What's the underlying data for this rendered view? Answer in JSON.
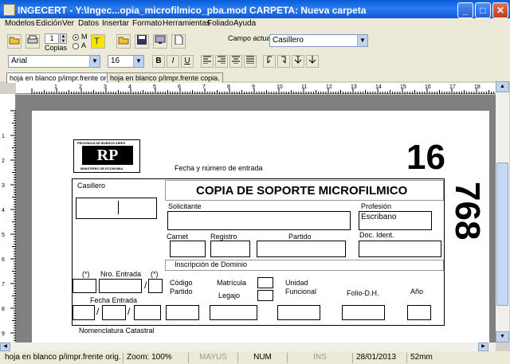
{
  "window": {
    "title": "INGECERT - Y:\\Ingec...opia_microfilmico_pba.mod   CARPETA: Nueva carpeta",
    "minimize": "_",
    "maximize": "□",
    "close": "✕"
  },
  "menu": [
    "Modelos",
    "Edición",
    "Ver",
    "Datos",
    "Insertar",
    "Formato",
    "Herramientas",
    "Foliado",
    "Ayuda"
  ],
  "toolbar1": {
    "copies_value": "1",
    "copies_label": "Copias",
    "radio_m": "M",
    "radio_a": "A",
    "campo_actual_label": "Campo actual",
    "campo_actual_value": "Casillero"
  },
  "toolbar2": {
    "font": "Arial",
    "size": "16",
    "bold": "B",
    "italic": "I",
    "underline": "U"
  },
  "tabs": [
    "hoja en blanco p/impr.frente orig.",
    "hoja en blanco p/impr.frente copia."
  ],
  "ruler_top": [
    "1",
    "2",
    "3",
    "4",
    "5",
    "6",
    "7",
    "8",
    "9",
    "10",
    "11",
    "12",
    "13",
    "14",
    "15",
    "16",
    "17",
    "18"
  ],
  "ruler_left": [
    "1",
    "2",
    "3",
    "4",
    "5",
    "6",
    "7",
    "8",
    "9",
    "10"
  ],
  "form": {
    "logo_top": "PROVINCIA DE BUENOS AIRES",
    "logo_letters": "RP",
    "logo_bottom": "MINISTERIO DE ECONOMIA",
    "fecha_nro_entrada": "Fecha y número de entrada",
    "number_16": "16",
    "number_768": "768",
    "title": "COPIA DE SOPORTE MICROFILMICO",
    "casillero": "Casillero",
    "solicitante": "Solicitante",
    "profesion": "Profesión",
    "profesion_value": "Escribano",
    "carnet": "Carnet",
    "registro": "Registro",
    "partido": "Partido",
    "doc_ident": "Doc. Ident.",
    "inscripcion": "Inscripción de Dominio",
    "star1": "(*)",
    "nro_entrada": "Nro. Entrada",
    "star2": "(*)",
    "codigo": "Código",
    "partido2": "Partido",
    "matricula": "Matrícula",
    "legajo": "Legajo",
    "unidad": "Unidad",
    "funcional": "Funcional",
    "folio": "Folio-D.H.",
    "anio": "Año",
    "fecha_entrada": "Fecha Entrada",
    "slash": "/",
    "nomenclatura": "Nomenclatura Catastral"
  },
  "status": {
    "page": "hoja en blanco p/impr.frente orig.",
    "zoom": "Zoom:  100%",
    "mayus": "MAYUS",
    "num": "NUM",
    "ins": "INS",
    "date": "28/01/2013",
    "mm": "52mm"
  }
}
